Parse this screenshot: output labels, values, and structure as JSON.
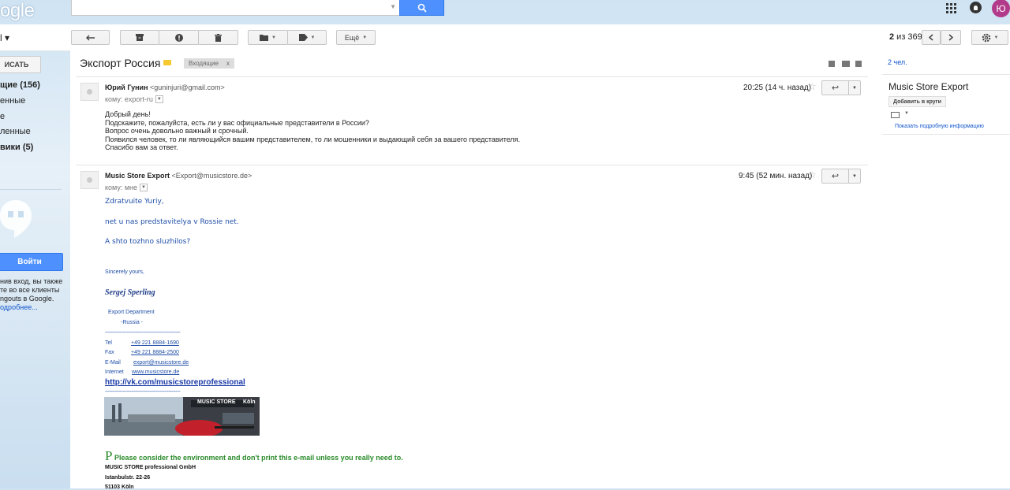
{
  "header": {
    "logo_text": "ogle",
    "search_placeholder": "",
    "avatar_letter": "Ю",
    "avatar_color": "#b23a8a"
  },
  "toolbar": {
    "mail_label": "l ▾",
    "more_label": "Ещё",
    "counter_current": "2",
    "counter_rest": " из 369",
    "icons": [
      "reply-icon",
      "archive-icon",
      "spam-icon",
      "delete-icon",
      "folder-icon",
      "label-icon",
      "settings-icon"
    ]
  },
  "sidebar": {
    "compose_label": "ИСАТЬ",
    "items": [
      {
        "label": "щие (156)",
        "bold": true
      },
      {
        "label": "енные",
        "bold": false
      },
      {
        "label": "е",
        "bold": false
      },
      {
        "label": "ленные",
        "bold": false
      },
      {
        "label": "вики (5)",
        "bold": true
      }
    ],
    "signin_label": "Войти",
    "signin_text_lines": [
      "нив вход, вы также",
      "те во все клиенты",
      "ngouts в Google."
    ],
    "more_link": "одробнее..."
  },
  "thread": {
    "subject": "Экспорт Россия",
    "label_color": "#f8c830",
    "inbox_tag": "Входящие",
    "inbox_tag_close": "x",
    "messages": [
      {
        "sender_name": "Юрий Гунин",
        "sender_email": "<guninjuri@gmail.com>",
        "to": "кому: export-ru",
        "time": "20:25 (14 ч. назад)",
        "body": [
          "Добрый день!",
          "Подскажите, пожалуйста, есть ли у вас официальные представители в России?",
          "Вопрос очень довольно важный и срочный.",
          "Появился человек, то ли являющийся вашим представителем, то ли мошенники и выдающий себя за вашего представителя.",
          "Спасибо вам за ответ."
        ]
      },
      {
        "sender_name": "Music Store Export",
        "sender_email": "<Export@musicstore.de>",
        "to": "кому: мне",
        "time": "9:45 (52 мин. назад)",
        "greeting": "Zdratvuite Yuriy,",
        "line1": "net u nas predstavitelya v Rossie net.",
        "line2": "A shto tozhno sluzhilos?",
        "closing": "Sincerely yours,",
        "signature_name": "Sergej Sperling",
        "department": "Export Department",
        "region": "-Russia -",
        "dashes": "----------------------------------------------------",
        "contacts": [
          {
            "key": "Tel",
            "value": "+49 221 8884-1690"
          },
          {
            "key": "Fax",
            "value": "+49 221 8884-2500"
          },
          {
            "key": "E-Mail",
            "value": "export@musicstore.de"
          },
          {
            "key": "Internet",
            "value": "www.musicstore.de"
          }
        ],
        "vk_link": "http://vk.com/musicstoreprofessional",
        "banner_brand": "MUSIC STORE",
        "banner_city": "Köln",
        "env_cap": "P",
        "env_note": "Please consider the environment and don't print this e-mail unless you really need to.",
        "address": [
          "MUSIC STORE professional GmbH",
          "Istanbulstr. 22-26",
          "51103 Köln"
        ]
      }
    ]
  },
  "right_pane": {
    "people_count": "2 чел.",
    "contact_name": "Music Store Export",
    "add_circle": "Добавить в круги",
    "details_link": "Показать подробную информацию"
  }
}
